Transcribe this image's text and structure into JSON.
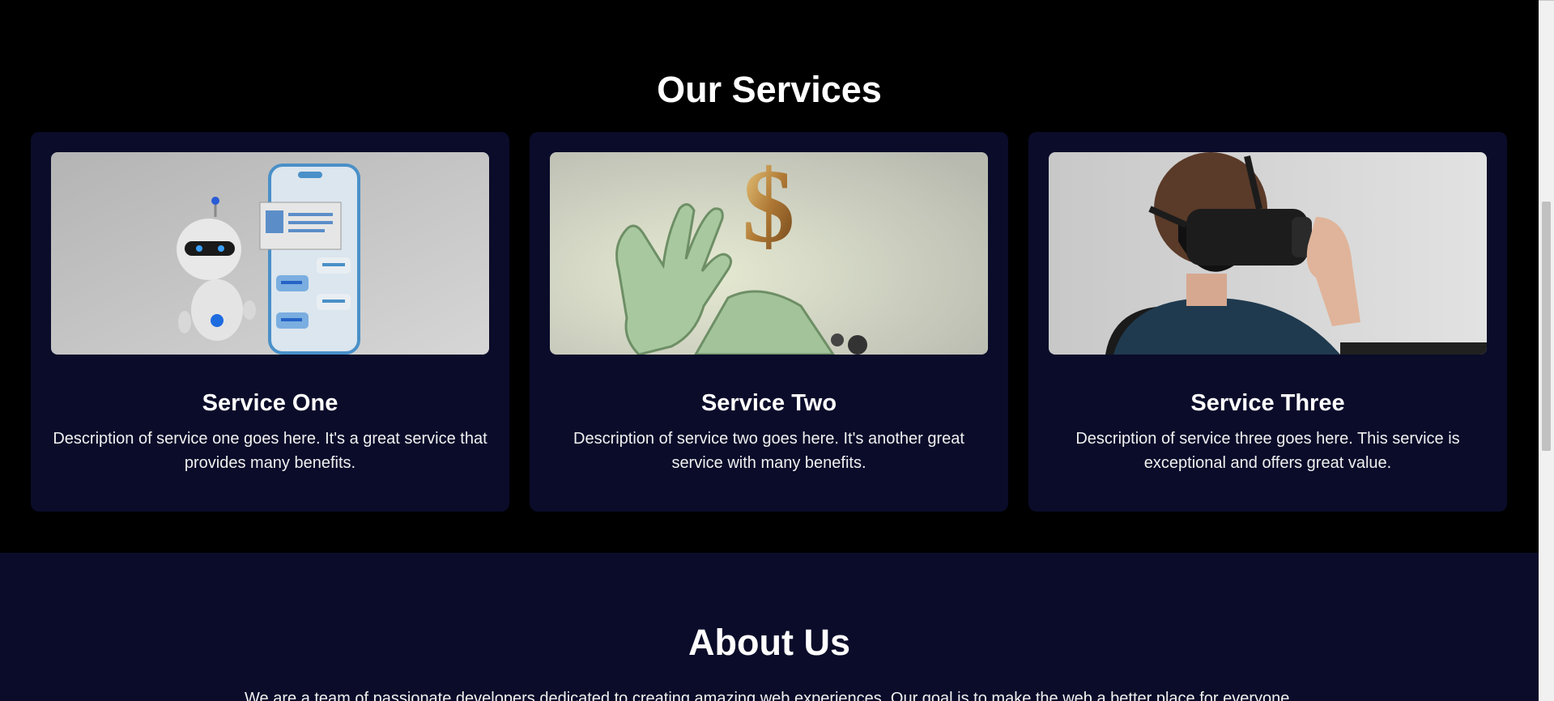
{
  "services": {
    "title": "Our Services",
    "cards": [
      {
        "title": "Service One",
        "description": "Description of service one goes here. It's a great service that provides many benefits.",
        "image": "robot-chatbot-phone-illustration"
      },
      {
        "title": "Service Two",
        "description": "Description of service two goes here. It's another great service with many benefits.",
        "image": "robotic-hand-dollar-sign"
      },
      {
        "title": "Service Three",
        "description": "Description of service three goes here. This service is exceptional and offers great value.",
        "image": "person-wearing-vr-headset"
      }
    ]
  },
  "about": {
    "title": "About Us",
    "text": "We are a team of passionate developers dedicated to creating amazing web experiences. Our goal is to make the web a better place for everyone."
  },
  "colors": {
    "page_background": "#000000",
    "card_background": "#0a0c2a",
    "about_background": "#0a0c2a",
    "text": "#ffffff"
  }
}
